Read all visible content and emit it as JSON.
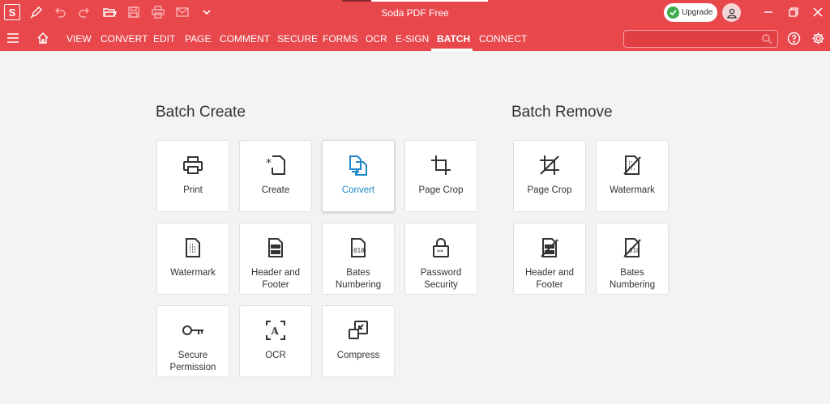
{
  "app": {
    "title": "Soda PDF Free",
    "logo_letter": "S",
    "upgrade_label": "Upgrade"
  },
  "menu": [
    {
      "label": "VIEW"
    },
    {
      "label": "CONVERT"
    },
    {
      "label": "EDIT"
    },
    {
      "label": "PAGE"
    },
    {
      "label": "COMMENT"
    },
    {
      "label": "SECURE"
    },
    {
      "label": "FORMS"
    },
    {
      "label": "OCR"
    },
    {
      "label": "E-SIGN"
    },
    {
      "label": "BATCH",
      "active": true
    },
    {
      "label": "CONNECT"
    }
  ],
  "search": {
    "placeholder": ""
  },
  "batch_create": {
    "title": "Batch Create",
    "tiles": [
      {
        "label": "Print",
        "icon": "printer-icon"
      },
      {
        "label": "Create",
        "icon": "new-document-icon"
      },
      {
        "label": "Convert",
        "icon": "convert-icon",
        "selected": true
      },
      {
        "label": "Page Crop",
        "icon": "crop-icon"
      },
      {
        "label": "Watermark",
        "icon": "watermark-icon"
      },
      {
        "label": "Header and Footer",
        "icon": "header-footer-icon"
      },
      {
        "label": "Bates Numbering",
        "icon": "bates-numbering-icon"
      },
      {
        "label": "Password Security",
        "icon": "padlock-icon"
      },
      {
        "label": "Secure Permission",
        "icon": "key-icon"
      },
      {
        "label": "OCR",
        "icon": "ocr-icon"
      },
      {
        "label": "Compress",
        "icon": "compress-icon"
      }
    ]
  },
  "batch_remove": {
    "title": "Batch Remove",
    "tiles": [
      {
        "label": "Page Crop",
        "icon": "crop-remove-icon"
      },
      {
        "label": "Watermark",
        "icon": "watermark-remove-icon"
      },
      {
        "label": "Header and Footer",
        "icon": "header-footer-remove-icon"
      },
      {
        "label": "Bates Numbering",
        "icon": "bates-remove-icon"
      }
    ]
  },
  "colors": {
    "brand": "#e8474c",
    "selected_text": "#1f87c7",
    "upgrade_check": "#3cad4b"
  }
}
